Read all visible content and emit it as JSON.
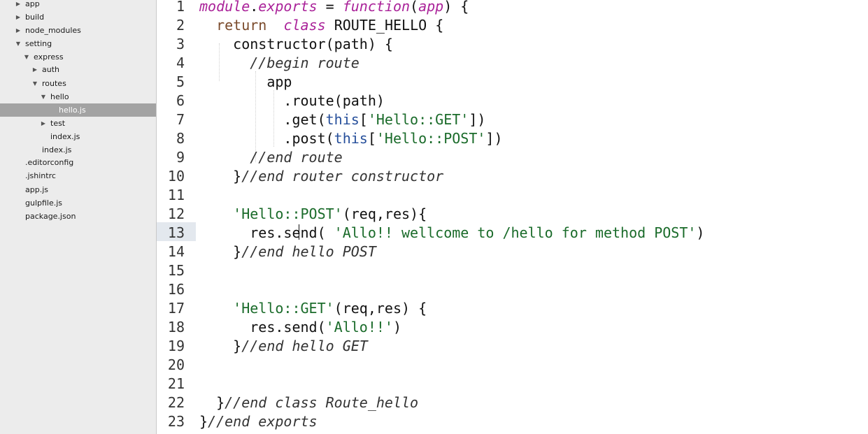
{
  "sidebar": {
    "items": [
      {
        "label": "app",
        "twisty": "▶"
      },
      {
        "label": "build",
        "twisty": "▶"
      },
      {
        "label": "node_modules",
        "twisty": "▶"
      },
      {
        "label": "setting",
        "twisty": "▼"
      },
      {
        "label": "express",
        "twisty": "▼"
      },
      {
        "label": "auth",
        "twisty": "▶"
      },
      {
        "label": "routes",
        "twisty": "▼"
      },
      {
        "label": "hello",
        "twisty": "▼"
      },
      {
        "label": "hello.js",
        "twisty": ""
      },
      {
        "label": "test",
        "twisty": "▶"
      },
      {
        "label": "index.js",
        "twisty": ""
      },
      {
        "label": "index.js",
        "twisty": ""
      },
      {
        "label": ".editorconfig",
        "twisty": ""
      },
      {
        "label": ".jshintrc",
        "twisty": ""
      },
      {
        "label": "app.js",
        "twisty": ""
      },
      {
        "label": "gulpfile.js",
        "twisty": ""
      },
      {
        "label": "package.json",
        "twisty": ""
      }
    ]
  },
  "editor": {
    "line_numbers": [
      "1",
      "2",
      "3",
      "4",
      "5",
      "6",
      "7",
      "8",
      "9",
      "10",
      "11",
      "12",
      "13",
      "14",
      "15",
      "16",
      "17",
      "18",
      "19",
      "20",
      "21",
      "22",
      "23"
    ],
    "lines": [
      [
        {
          "t": "module",
          "c": "fn"
        },
        {
          "t": ".",
          "c": "pn"
        },
        {
          "t": "exports",
          "c": "fn"
        },
        {
          "t": " = ",
          "c": "pn"
        },
        {
          "t": "function",
          "c": "fn"
        },
        {
          "t": "(",
          "c": "pn"
        },
        {
          "t": "app",
          "c": "fn"
        },
        {
          "t": ") {",
          "c": "pn"
        }
      ],
      [
        {
          "t": "  ",
          "c": "pn"
        },
        {
          "t": "return",
          "c": "kw"
        },
        {
          "t": "  ",
          "c": "pn"
        },
        {
          "t": "class",
          "c": "fn"
        },
        {
          "t": " ROUTE_HELLO {",
          "c": "pn"
        }
      ],
      [
        {
          "t": "    constructor(path) {",
          "c": "pn"
        }
      ],
      [
        {
          "t": "      ",
          "c": "pn"
        },
        {
          "t": "//begin route",
          "c": "cm"
        }
      ],
      [
        {
          "t": "        app",
          "c": "pn"
        }
      ],
      [
        {
          "t": "          .route(path)",
          "c": "pn"
        }
      ],
      [
        {
          "t": "          .get(",
          "c": "pn"
        },
        {
          "t": "this",
          "c": "th"
        },
        {
          "t": "[",
          "c": "pn"
        },
        {
          "t": "'Hello::GET'",
          "c": "str"
        },
        {
          "t": "])",
          "c": "pn"
        }
      ],
      [
        {
          "t": "          .post(",
          "c": "pn"
        },
        {
          "t": "this",
          "c": "th"
        },
        {
          "t": "[",
          "c": "pn"
        },
        {
          "t": "'Hello::POST'",
          "c": "str"
        },
        {
          "t": "])",
          "c": "pn"
        }
      ],
      [
        {
          "t": "      ",
          "c": "pn"
        },
        {
          "t": "//end route",
          "c": "cm"
        }
      ],
      [
        {
          "t": "    }",
          "c": "pn"
        },
        {
          "t": "//end router constructor",
          "c": "cm"
        }
      ],
      [
        {
          "t": "",
          "c": "pn"
        }
      ],
      [
        {
          "t": "    ",
          "c": "pn"
        },
        {
          "t": "'Hello::POST'",
          "c": "str"
        },
        {
          "t": "(req,res){",
          "c": "pn"
        }
      ],
      [
        {
          "t": "      res.send( ",
          "c": "pn"
        },
        {
          "t": "'Allo!! wellcome to /hello for method POST'",
          "c": "str"
        },
        {
          "t": ")",
          "c": "pn"
        }
      ],
      [
        {
          "t": "    }",
          "c": "pn"
        },
        {
          "t": "//end hello POST",
          "c": "cm"
        }
      ],
      [
        {
          "t": "",
          "c": "pn"
        }
      ],
      [
        {
          "t": "",
          "c": "pn"
        }
      ],
      [
        {
          "t": "    ",
          "c": "pn"
        },
        {
          "t": "'Hello::GET'",
          "c": "str"
        },
        {
          "t": "(req,res) {",
          "c": "pn"
        }
      ],
      [
        {
          "t": "      res.send(",
          "c": "pn"
        },
        {
          "t": "'Allo!!'",
          "c": "str"
        },
        {
          "t": ")",
          "c": "pn"
        }
      ],
      [
        {
          "t": "    }",
          "c": "pn"
        },
        {
          "t": "//end hello GET",
          "c": "cm"
        }
      ],
      [
        {
          "t": "",
          "c": "pn"
        }
      ],
      [
        {
          "t": "",
          "c": "pn"
        }
      ],
      [
        {
          "t": "  }",
          "c": "pn"
        },
        {
          "t": "//end class Route_hello",
          "c": "cm"
        }
      ],
      [
        {
          "t": "}",
          "c": "pn"
        },
        {
          "t": "//end exports",
          "c": "cm"
        }
      ]
    ]
  }
}
